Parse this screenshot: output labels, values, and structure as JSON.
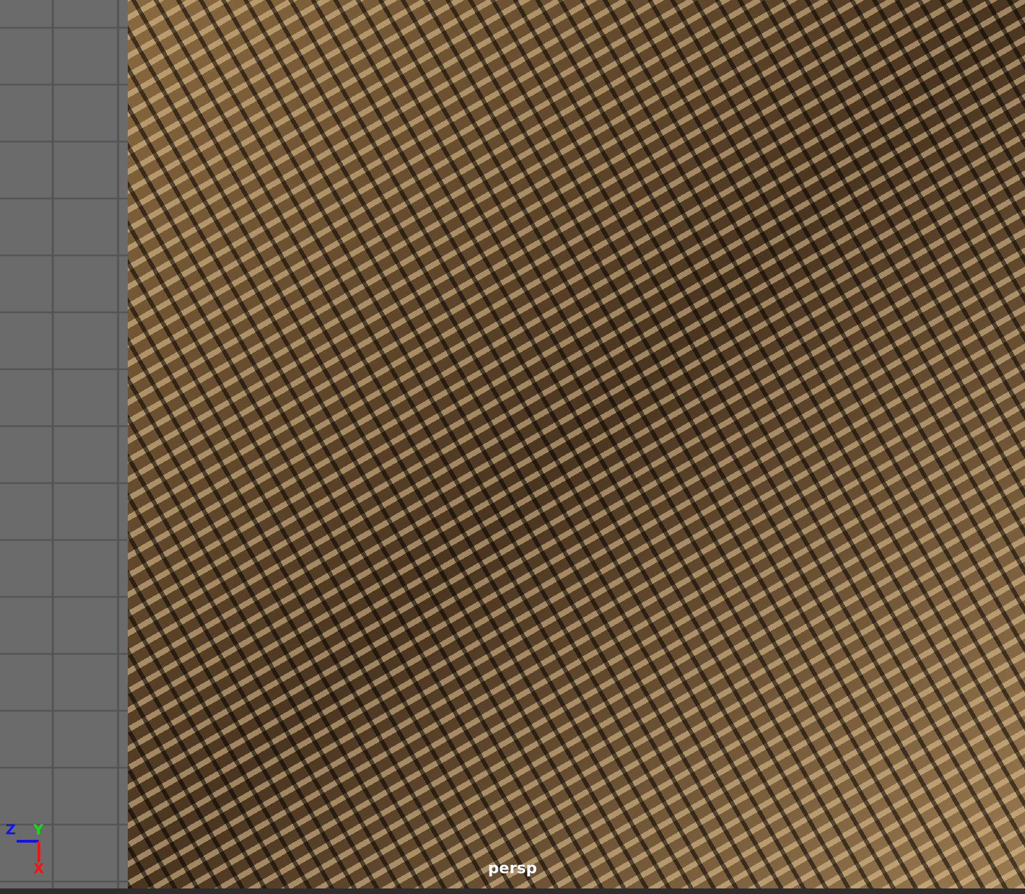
{
  "viewport": {
    "camera_label": "persp",
    "axes": [
      {
        "label": "Z",
        "color": "#1010ff"
      },
      {
        "label": "Y",
        "color": "#10e010"
      },
      {
        "label": "X",
        "color": "#ff1010"
      }
    ]
  }
}
